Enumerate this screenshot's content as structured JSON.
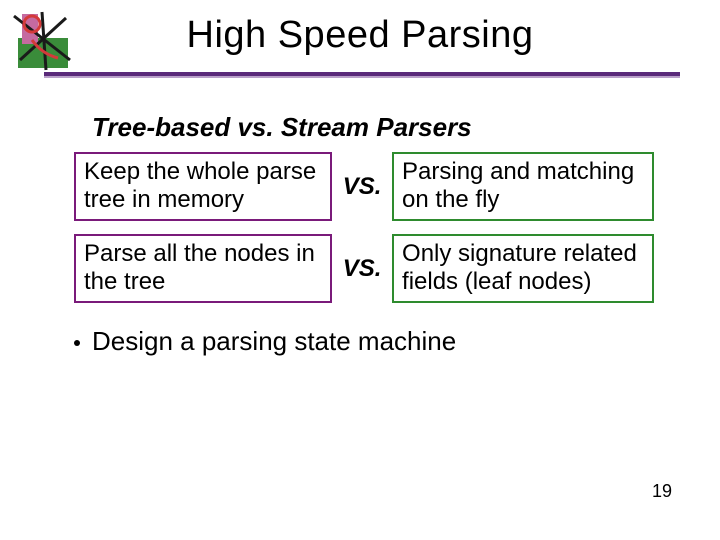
{
  "title": "High Speed Parsing",
  "subhead": "Tree-based vs. Stream Parsers",
  "rows": [
    {
      "left": "Keep the whole parse tree in memory",
      "vs": "VS.",
      "right": "Parsing and matching on the fly"
    },
    {
      "left": "Parse all the nodes in the tree",
      "vs": "VS.",
      "right": "Only signature related fields (leaf nodes)"
    }
  ],
  "bullet": "Design a parsing state machine",
  "page_number": "19",
  "colors": {
    "rule": "#5a2a7a",
    "left_border": "#7a1a7a",
    "right_border": "#2e8b2e"
  }
}
